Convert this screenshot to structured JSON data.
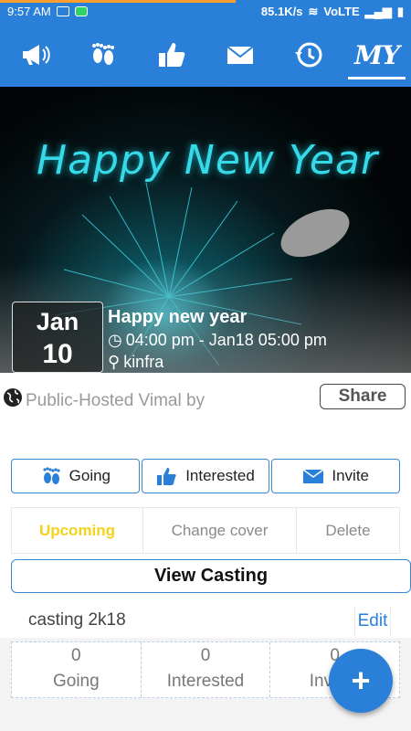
{
  "status_bar": {
    "time": "9:57 AM",
    "net_speed": "85.1K/s",
    "carrier": "VoLTE"
  },
  "tabs": [
    {
      "icon": "megaphone-icon"
    },
    {
      "icon": "footprints-icon"
    },
    {
      "icon": "thumbs-up-icon"
    },
    {
      "icon": "envelope-icon"
    },
    {
      "icon": "history-icon"
    },
    {
      "label": "MY",
      "active": true
    }
  ],
  "banner": {
    "headline": "Happy New Year"
  },
  "event": {
    "month": "Jan",
    "day": "10",
    "title": "Happy new year",
    "time": "04:00 pm - Jan18 05:00 pm",
    "place": "kinfra"
  },
  "info": {
    "hosted_text": "Public-Hosted   Vimal by",
    "share_label": "Share"
  },
  "actions": {
    "going": "Going",
    "interested": "Interested",
    "invite": "Invite"
  },
  "manage": {
    "upcoming": "Upcoming",
    "change_cover": "Change cover",
    "delete": "Delete"
  },
  "view_casting": "View Casting",
  "casting": {
    "name": "casting 2k18",
    "edit": "Edit"
  },
  "stats": [
    {
      "value": "0",
      "label": "Going"
    },
    {
      "value": "0",
      "label": "Interested"
    },
    {
      "value": "0",
      "label": "Invited"
    }
  ],
  "fab": "+",
  "colors": {
    "primary": "#2a80d8",
    "upcoming": "#f2d21a",
    "progress": "#ff9d2f"
  }
}
